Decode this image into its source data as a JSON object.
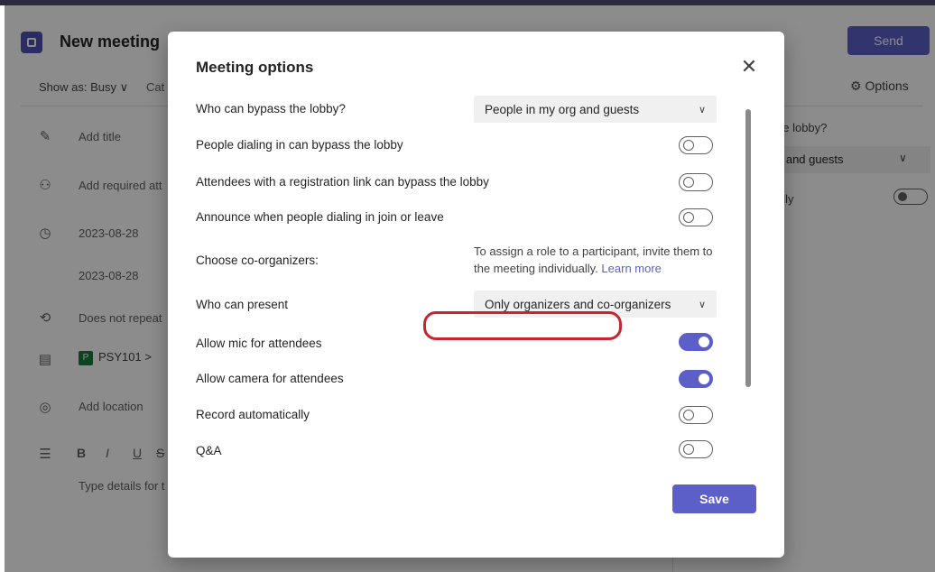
{
  "background_app": {
    "title": "New meeting",
    "send_label": "Send",
    "show_as": "Show as: Busy ∨",
    "category": "Cat",
    "options_label": "Options",
    "fields": {
      "title_placeholder": "Add title",
      "attendees_placeholder": "Add required att",
      "start_date": "2023-08-28",
      "end_date": "2023-08-28",
      "repeat": "Does not repeat",
      "channel_badge": "P",
      "channel": "PSY101",
      "channel_arrow": ">",
      "location_placeholder": "Add location",
      "details_placeholder": "Type details for t"
    },
    "format_bold": "B",
    "format_italic": "I",
    "format_underline": "U",
    "format_strike": "S",
    "right_panel": {
      "lobby_label_partial": "he lobby?",
      "select_partial": "g and guests",
      "toggle_label_partial": "ally"
    }
  },
  "dialog": {
    "title": "Meeting options",
    "close_glyph": "✕",
    "options": [
      {
        "label": "Who can bypass the lobby?",
        "control": "select",
        "value": "People in my org and guests"
      },
      {
        "label": "People dialing in can bypass the lobby",
        "control": "toggle",
        "on": false
      },
      {
        "label": "Attendees with a registration link can bypass the lobby",
        "control": "toggle",
        "on": false
      },
      {
        "label": "Announce when people dialing in join or leave",
        "control": "toggle",
        "on": false
      },
      {
        "label": "Choose co-organizers:",
        "control": "note"
      },
      {
        "label": "Who can present",
        "control": "select",
        "value": "Only organizers and co-organizers"
      },
      {
        "label": "Allow mic for attendees",
        "control": "toggle",
        "on": true
      },
      {
        "label": "Allow camera for attendees",
        "control": "toggle",
        "on": true
      },
      {
        "label": "Record automatically",
        "control": "toggle",
        "on": false
      },
      {
        "label": "Q&A",
        "control": "toggle",
        "on": false
      }
    ],
    "coorganizer_note": "To assign a role to a participant, invite them to the meeting individually.",
    "learn_more": "Learn more",
    "save_label": "Save",
    "chevron_glyph": "∨"
  },
  "colors": {
    "accent": "#5b5fc7",
    "highlight_annotation": "#c8262c"
  }
}
